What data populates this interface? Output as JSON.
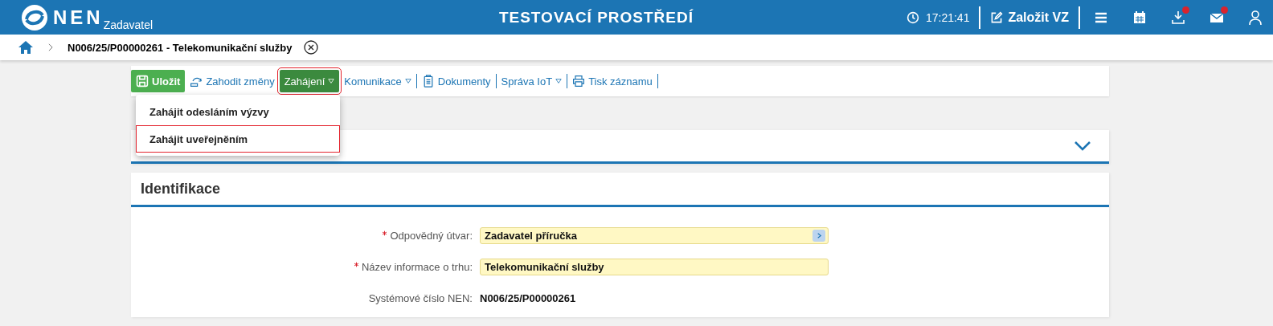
{
  "header": {
    "logo": "NEN",
    "role": "Zadavatel",
    "environment": "TESTOVACÍ PROSTŘEDÍ",
    "time": "17:21:41",
    "create_button": "Založit VZ",
    "icons": [
      {
        "kind": "menu",
        "badge": false
      },
      {
        "kind": "calendar",
        "badge": false
      },
      {
        "kind": "download",
        "badge": true
      },
      {
        "kind": "mail",
        "badge": true
      },
      {
        "kind": "user",
        "badge": false
      }
    ]
  },
  "breadcrumb": {
    "title": "N006/25/P00000261 - Telekomunikační služby"
  },
  "toolbar": [
    {
      "kind": "save",
      "label": "Uložit",
      "highlighted": false
    },
    {
      "kind": "discard",
      "label": "Zahodit změny",
      "highlighted": false
    },
    {
      "kind": "dropdown-active",
      "label": "Zahájení",
      "highlighted": true
    },
    {
      "kind": "dropdown",
      "label": "Komunikace",
      "highlighted": false
    },
    {
      "kind": "documents",
      "label": "Dokumenty",
      "highlighted": false
    },
    {
      "kind": "dropdown",
      "label": "Správa IoT",
      "highlighted": false
    },
    {
      "kind": "print",
      "label": "Tisk záznamu",
      "highlighted": false
    }
  ],
  "dropdown_menu": [
    {
      "label": "Zahájit odesláním výzvy",
      "highlighted": false
    },
    {
      "label": "Zahájit uveřejněním",
      "highlighted": true
    }
  ],
  "collapsed_panel": {
    "expanded": false
  },
  "section": {
    "title": "Identifikace",
    "fields": [
      {
        "kind": "picker",
        "label": "Odpovědný útvar:",
        "required": true,
        "value": "Zadavatel příručka"
      },
      {
        "kind": "input",
        "label": "Název informace o trhu:",
        "required": true,
        "value": "Telekomunikační služby"
      },
      {
        "kind": "text",
        "label": "Systémové číslo NEN:",
        "required": false,
        "value": "N006/25/P00000261"
      }
    ]
  }
}
